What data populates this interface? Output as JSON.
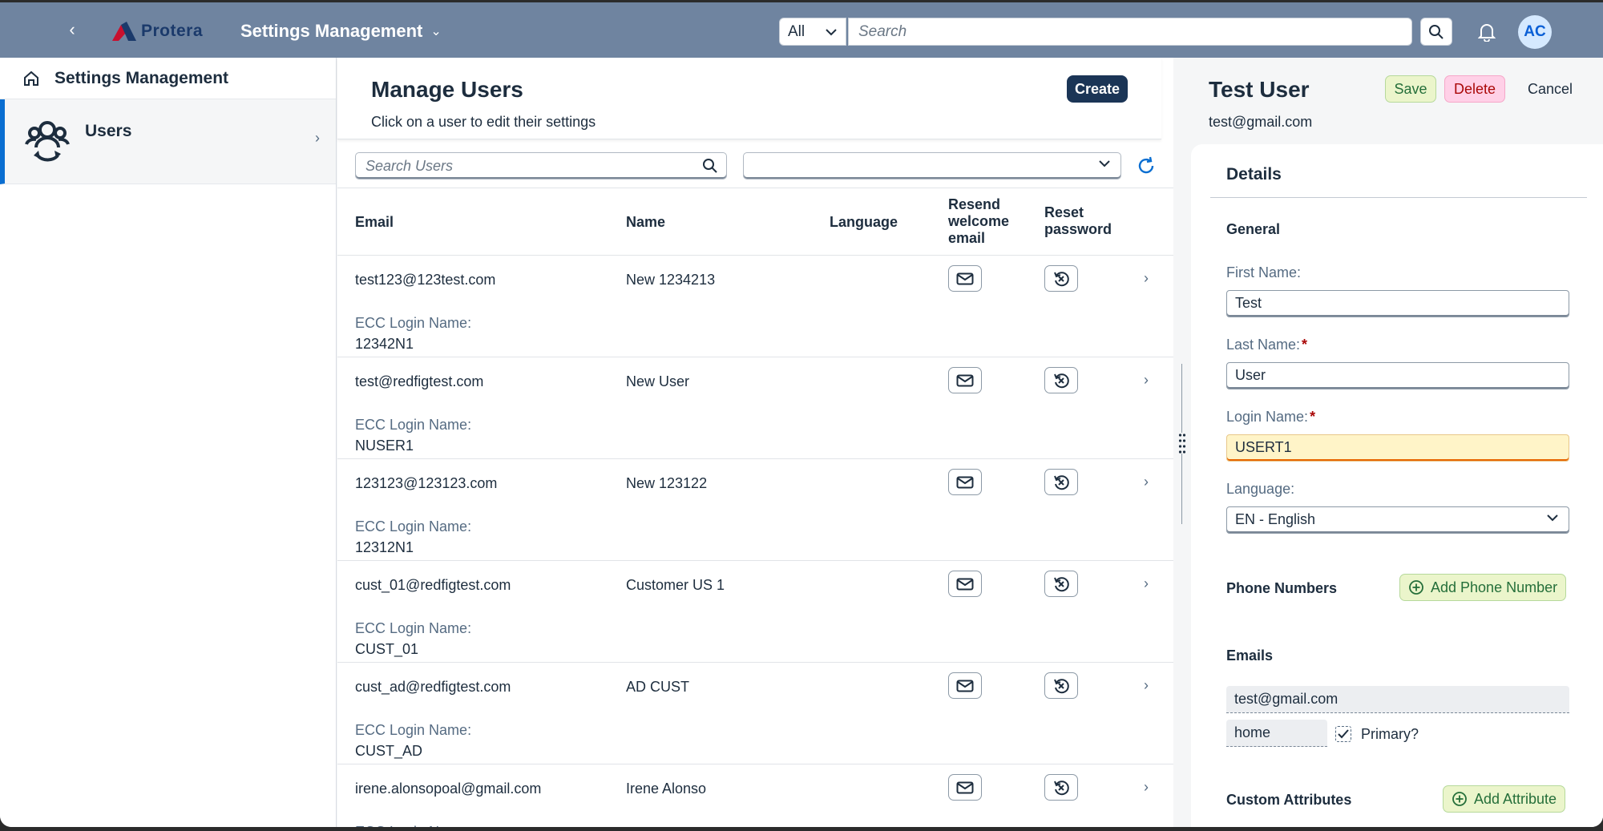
{
  "shell": {
    "logo_text": "Protera",
    "app_title": "Settings Management",
    "scope": "All",
    "search_placeholder": "Search",
    "avatar": "AC"
  },
  "nav": {
    "header": "Settings Management",
    "items": [
      {
        "label": "Users"
      }
    ]
  },
  "list": {
    "title": "Manage Users",
    "subtitle": "Click on a user to edit their settings",
    "create_label": "Create",
    "search_placeholder": "Search Users",
    "filter_value": "",
    "columns": {
      "email": "Email",
      "name": "Name",
      "language": "Language",
      "resend": "Resend welcome email",
      "reset": "Reset password"
    },
    "ecc_label": "ECC Login Name:",
    "rows": [
      {
        "email": "test123@123test.com",
        "name": "New 1234213",
        "ecc": "12342N1"
      },
      {
        "email": "test@redfigtest.com",
        "name": "New User",
        "ecc": "NUSER1"
      },
      {
        "email": "123123@123123.com",
        "name": "New 123122",
        "ecc": "12312N1"
      },
      {
        "email": "cust_01@redfigtest.com",
        "name": "Customer US 1",
        "ecc": "CUST_01"
      },
      {
        "email": "cust_ad@redfigtest.com",
        "name": "AD CUST",
        "ecc": "CUST_AD"
      },
      {
        "email": "irene.alonsopoal@gmail.com",
        "name": "Irene Alonso",
        "ecc": ""
      }
    ]
  },
  "detail": {
    "name": "Test User",
    "email": "test@gmail.com",
    "save_label": "Save",
    "delete_label": "Delete",
    "cancel_label": "Cancel",
    "tab": "Details",
    "general": "General",
    "first_name_label": "First Name:",
    "first_name": "Test",
    "last_name_label": "Last Name:",
    "last_name": "User",
    "login_name_label": "Login Name:",
    "login_name": "USERT1",
    "language_label": "Language:",
    "language": "EN - English",
    "phone_section": "Phone Numbers",
    "add_phone": "Add Phone Number",
    "emails_section": "Emails",
    "email_value": "test@gmail.com",
    "email_type": "home",
    "primary_label": "Primary?",
    "custom_section": "Custom Attributes",
    "add_attr": "Add Attribute"
  },
  "colors": {
    "shell": "#6f84a0",
    "accent": "#0a6ed1",
    "create": "#1b3556"
  }
}
